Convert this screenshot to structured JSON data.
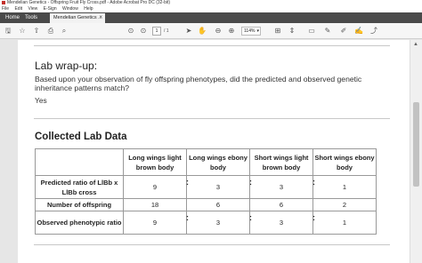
{
  "window": {
    "title": "Mendelian Genetics - Offspring Fruit Fly Cross.pdf - Adobe Acrobat Pro DC (32-bit)"
  },
  "menu": [
    "File",
    "Edit",
    "View",
    "E-Sign",
    "Window",
    "Help"
  ],
  "tabs": {
    "home": "Home",
    "tools": "Tools",
    "document": "Mendelian Genetics ...",
    "close": "×"
  },
  "toolbar": {
    "page_current": "1",
    "page_total": "/ 1",
    "zoom": "114%"
  },
  "document": {
    "wrapup_heading": "Lab wrap-up:",
    "question": "Based upon your observation of fly offspring phenotypes, did the predicted and observed genetic inheritance patterns match?",
    "answer": "Yes",
    "data_heading": "Collected Lab Data",
    "table": {
      "columns": [
        "Long wings light brown body",
        "Long wings ebony body",
        "Short wings light brown body",
        "Short wings ebony body"
      ],
      "rows": [
        {
          "label": "Predicted ratio of LlBb x LlBb cross",
          "values": [
            "9",
            "3",
            "3",
            "1"
          ]
        },
        {
          "label": "Number of offspring",
          "values": [
            "18",
            "6",
            "6",
            "2"
          ]
        },
        {
          "label": "Observed phenotypic ratio",
          "values": [
            "9",
            "3",
            "3",
            "1"
          ]
        }
      ],
      "separator": ":"
    }
  }
}
